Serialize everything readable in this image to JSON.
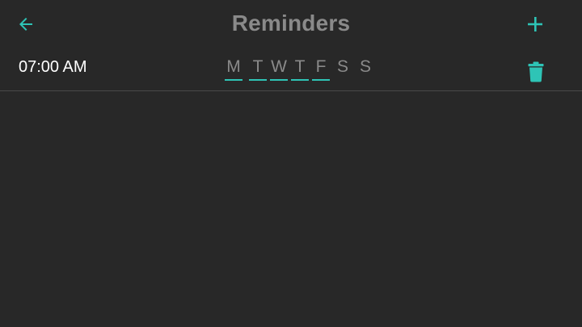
{
  "app": {
    "title": "Reminders",
    "accent_color": "#2ec4b6",
    "background_color": "#282828"
  },
  "toolbar": {
    "back_icon": "arrow-left-icon",
    "add_icon": "plus-icon"
  },
  "reminders": [
    {
      "time": "07:00 AM",
      "days": [
        {
          "label": "M",
          "selected": true
        },
        {
          "label": "T",
          "selected": true
        },
        {
          "label": "W",
          "selected": true
        },
        {
          "label": "T",
          "selected": true
        },
        {
          "label": "F",
          "selected": true
        },
        {
          "label": "S",
          "selected": false
        },
        {
          "label": "S",
          "selected": false
        }
      ],
      "delete_icon": "trash-icon"
    }
  ]
}
